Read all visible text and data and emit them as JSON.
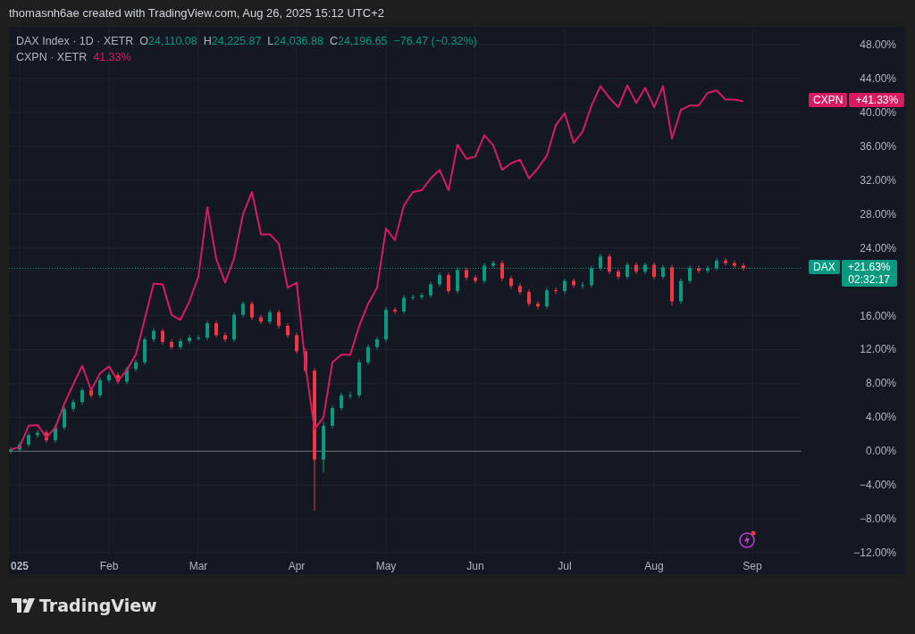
{
  "header": {
    "text": "thomasnh6ae created with TradingView.com, Aug 26, 2025 15:12 UTC+2"
  },
  "legend": [
    {
      "symbol": "DAX Index · 1D · XETR",
      "fields": [
        {
          "key": "O",
          "value": "24,110.08"
        },
        {
          "key": "H",
          "value": "24,225.87"
        },
        {
          "key": "L",
          "value": "24,036.88"
        },
        {
          "key": "C",
          "value": "24,196.65"
        }
      ],
      "change": "−76.47 (−0.32%)"
    },
    {
      "symbol": "CXPN · XETR",
      "change": "41.33%"
    }
  ],
  "chart_data": {
    "type": "candlestick",
    "grid": true,
    "ref_lines": [
      {
        "axis": "y",
        "value": 21.6,
        "color": "#089981"
      }
    ],
    "categories": [
      null,
      "025",
      null,
      null,
      null,
      null,
      null,
      null,
      null,
      null,
      null,
      "Feb",
      null,
      null,
      null,
      null,
      null,
      null,
      null,
      null,
      null,
      "Mar",
      null,
      null,
      null,
      null,
      null,
      null,
      null,
      null,
      null,
      null,
      "Apr",
      null,
      null,
      null,
      null,
      null,
      null,
      null,
      null,
      null,
      "May",
      null,
      null,
      null,
      null,
      null,
      null,
      null,
      null,
      null,
      "Jun",
      null,
      null,
      null,
      null,
      null,
      null,
      null,
      null,
      null,
      "Jul",
      null,
      null,
      null,
      null,
      null,
      null,
      null,
      null,
      null,
      "Aug",
      null,
      null,
      null,
      null,
      null,
      null,
      null,
      null,
      null,
      null,
      "Sep",
      null,
      null,
      null,
      null,
      null
    ],
    "ohlc": [
      [
        0,
        0.5,
        -0.3,
        0.2
      ],
      [
        0.2,
        1.1,
        -0.1,
        0.8
      ],
      [
        0.8,
        2.2,
        0.5,
        1.9
      ],
      [
        1.9,
        2.5,
        1.6,
        2.2
      ],
      [
        2.2,
        2.5,
        1.0,
        1.3
      ],
      [
        1.3,
        3.1,
        1.0,
        2.8
      ],
      [
        2.8,
        5.3,
        2.5,
        5.0
      ],
      [
        5.0,
        6.1,
        4.7,
        5.8
      ],
      [
        5.8,
        7.5,
        5.5,
        7.2
      ],
      [
        7.2,
        7.5,
        6.3,
        6.6
      ],
      [
        6.6,
        8.7,
        6.3,
        8.4
      ],
      [
        8.4,
        9.3,
        8.1,
        9.0
      ],
      [
        9.0,
        9.3,
        7.9,
        8.2
      ],
      [
        8.2,
        10.0,
        7.9,
        9.7
      ],
      [
        9.7,
        10.8,
        9.4,
        10.5
      ],
      [
        10.5,
        13.5,
        10.2,
        13.2
      ],
      [
        13.2,
        14.5,
        12.9,
        14.2
      ],
      [
        14.2,
        14.5,
        12.6,
        12.9
      ],
      [
        12.9,
        13.2,
        12.0,
        12.3
      ],
      [
        12.3,
        13.3,
        12.0,
        13.0
      ],
      [
        13.0,
        13.7,
        12.7,
        13.4
      ],
      [
        13.4,
        13.7,
        13.1,
        13.4
      ],
      [
        13.4,
        15.4,
        13.1,
        15.1
      ],
      [
        15.1,
        15.4,
        13.4,
        13.7
      ],
      [
        13.7,
        14.0,
        12.9,
        13.2
      ],
      [
        13.2,
        16.4,
        12.9,
        16.1
      ],
      [
        16.1,
        17.7,
        15.8,
        17.4
      ],
      [
        17.4,
        17.7,
        15.5,
        15.8
      ],
      [
        15.8,
        16.1,
        15.0,
        15.3
      ],
      [
        15.3,
        16.7,
        15.0,
        16.4
      ],
      [
        16.4,
        16.7,
        14.5,
        14.8
      ],
      [
        14.8,
        15.1,
        13.4,
        13.7
      ],
      [
        13.7,
        14.0,
        11.5,
        11.8
      ],
      [
        11.8,
        12.1,
        9.2,
        9.5
      ],
      [
        9.5,
        9.8,
        -7.0,
        -1.0
      ],
      [
        -1.0,
        3.5,
        -2.5,
        3.0
      ],
      [
        3.0,
        5.4,
        2.7,
        5.1
      ],
      [
        5.1,
        6.9,
        4.8,
        6.6
      ],
      [
        6.6,
        7.0,
        6.2,
        6.6
      ],
      [
        6.6,
        10.8,
        6.3,
        10.5
      ],
      [
        10.5,
        12.6,
        10.2,
        12.3
      ],
      [
        12.3,
        13.5,
        12.0,
        13.2
      ],
      [
        13.2,
        17.0,
        12.9,
        16.7
      ],
      [
        16.7,
        17.0,
        16.2,
        16.5
      ],
      [
        16.5,
        18.4,
        16.2,
        18.1
      ],
      [
        18.1,
        18.5,
        17.8,
        18.2
      ],
      [
        18.2,
        18.7,
        17.9,
        18.4
      ],
      [
        18.4,
        20.0,
        18.1,
        19.7
      ],
      [
        19.7,
        21.1,
        19.4,
        20.8
      ],
      [
        20.8,
        21.1,
        18.6,
        18.9
      ],
      [
        18.9,
        21.7,
        18.6,
        21.4
      ],
      [
        21.4,
        21.7,
        20.2,
        20.5
      ],
      [
        20.5,
        20.8,
        19.8,
        20.1
      ],
      [
        20.1,
        22.2,
        19.8,
        21.9
      ],
      [
        21.9,
        22.5,
        21.6,
        22.2
      ],
      [
        22.2,
        22.5,
        20.1,
        20.4
      ],
      [
        20.4,
        20.7,
        19.2,
        19.5
      ],
      [
        19.5,
        19.8,
        18.5,
        18.8
      ],
      [
        18.8,
        19.1,
        17.1,
        17.4
      ],
      [
        17.4,
        17.7,
        16.8,
        17.1
      ],
      [
        17.1,
        19.3,
        16.8,
        19.0
      ],
      [
        19.0,
        19.3,
        18.6,
        18.9
      ],
      [
        18.9,
        20.4,
        18.6,
        20.1
      ],
      [
        20.1,
        20.4,
        19.3,
        19.6
      ],
      [
        19.6,
        20.0,
        19.2,
        19.6
      ],
      [
        19.6,
        21.9,
        19.3,
        21.6
      ],
      [
        21.6,
        23.3,
        21.3,
        23.0
      ],
      [
        23.0,
        23.3,
        20.9,
        21.2
      ],
      [
        21.2,
        21.5,
        20.3,
        20.6
      ],
      [
        20.6,
        22.3,
        20.3,
        22.0
      ],
      [
        22.0,
        22.3,
        20.9,
        21.2
      ],
      [
        21.2,
        22.3,
        20.9,
        22.0
      ],
      [
        22.0,
        22.3,
        20.3,
        20.6
      ],
      [
        20.6,
        22.0,
        20.3,
        21.7
      ],
      [
        21.7,
        22.0,
        17.2,
        17.7
      ],
      [
        17.7,
        20.4,
        17.4,
        20.1
      ],
      [
        20.1,
        21.9,
        19.8,
        21.6
      ],
      [
        21.6,
        21.9,
        21.0,
        21.3
      ],
      [
        21.3,
        21.9,
        21.0,
        21.6
      ],
      [
        21.6,
        22.8,
        21.3,
        22.5
      ],
      [
        22.5,
        22.8,
        21.9,
        22.2
      ],
      [
        22.2,
        22.5,
        21.6,
        21.9
      ],
      [
        21.9,
        22.2,
        21.3,
        21.6
      ],
      null,
      null,
      null,
      null,
      null,
      null
    ],
    "series": [
      {
        "name": "CXPN",
        "type": "line",
        "color": "#d81b60",
        "values": [
          0.2,
          0.5,
          3.0,
          3.1,
          1.6,
          2.8,
          5.6,
          7.9,
          10.1,
          7.2,
          9.2,
          10.0,
          8.3,
          9.6,
          11.4,
          15.6,
          19.8,
          19.7,
          16.1,
          15.5,
          17.7,
          20.6,
          28.8,
          22.7,
          19.9,
          22.8,
          28.0,
          30.6,
          25.6,
          25.6,
          24.5,
          19.3,
          19.9,
          10.0,
          2.6,
          4.0,
          10.5,
          11.4,
          11.4,
          14.8,
          17.4,
          19.3,
          26.3,
          24.9,
          29.0,
          30.6,
          30.8,
          32.2,
          33.2,
          30.8,
          36.2,
          34.5,
          34.8,
          37.3,
          36.1,
          33.2,
          34.0,
          34.4,
          32.2,
          33.4,
          34.9,
          38.5,
          39.9,
          36.4,
          37.7,
          40.8,
          43.1,
          41.7,
          40.6,
          43.2,
          41.1,
          42.9,
          40.6,
          43.1,
          36.9,
          40.3,
          40.8,
          40.8,
          42.3,
          42.6,
          41.5,
          41.5,
          41.3,
          null,
          null,
          null,
          null,
          null,
          null
        ]
      }
    ],
    "ylim": [
      -12.3,
      50.1
    ],
    "yticks": [
      {
        "value": 48,
        "label": "48.00%"
      },
      {
        "value": 44,
        "label": "44.00%"
      },
      {
        "value": 40,
        "label": "40.00%"
      },
      {
        "value": 36,
        "label": "36.00%"
      },
      {
        "value": 32,
        "label": "32.00%"
      },
      {
        "value": 28,
        "label": "28.00%"
      },
      {
        "value": 24,
        "label": "24.00%"
      },
      {
        "value": 16,
        "label": "16.00%"
      },
      {
        "value": 12,
        "label": "12.00%"
      },
      {
        "value": 8,
        "label": "8.00%"
      },
      {
        "value": 4,
        "label": "4.00%"
      },
      {
        "value": 0,
        "label": "0.00%"
      },
      {
        "value": -4,
        "label": "−4.00%"
      },
      {
        "value": -8,
        "label": "−8.00%"
      },
      {
        "value": -12,
        "label": "−12.00%"
      }
    ]
  },
  "price_tags": [
    {
      "value": "+41.33%"
    },
    {
      "label": "DAX",
      "value": "+21.63%",
      "countdown": "02:32:17"
    }
  ],
  "footer": {
    "brand": "TradingView"
  }
}
